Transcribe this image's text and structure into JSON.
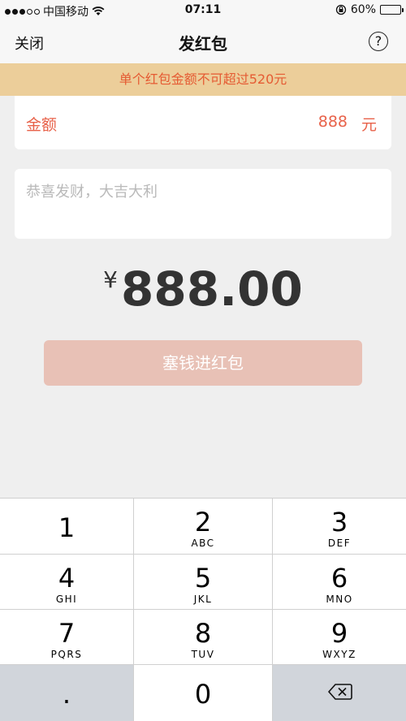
{
  "status_bar": {
    "carrier": "中国移动",
    "time": "07:11",
    "battery": "60%",
    "battery_level": 0.6,
    "signal_bars_filled": 3,
    "signal_bars_total": 5
  },
  "navbar": {
    "close_label": "关闭",
    "title": "发红包",
    "help_label": "?"
  },
  "warning": "单个红包金额不可超过520元",
  "amount_field": {
    "label": "金额",
    "value": "888",
    "unit": "元"
  },
  "greeting": {
    "placeholder": "恭喜发财，大吉大利"
  },
  "total": {
    "currency": "¥",
    "amount": "888.00"
  },
  "submit_label": "塞钱进红包",
  "keypad": {
    "keys": [
      {
        "digit": "1",
        "letters": ""
      },
      {
        "digit": "2",
        "letters": "ABC"
      },
      {
        "digit": "3",
        "letters": "DEF"
      },
      {
        "digit": "4",
        "letters": "GHI"
      },
      {
        "digit": "5",
        "letters": "JKL"
      },
      {
        "digit": "6",
        "letters": "MNO"
      },
      {
        "digit": "7",
        "letters": "PQRS"
      },
      {
        "digit": "8",
        "letters": "TUV"
      },
      {
        "digit": "9",
        "letters": "WXYZ"
      },
      {
        "digit": ".",
        "letters": ""
      },
      {
        "digit": "0",
        "letters": ""
      }
    ],
    "delete_icon": "backspace-icon"
  },
  "colors": {
    "accent": "#e8624a",
    "warning_bg": "#ecce9a",
    "warning_text": "#e55b33",
    "button_bg": "#e8c1b6"
  }
}
